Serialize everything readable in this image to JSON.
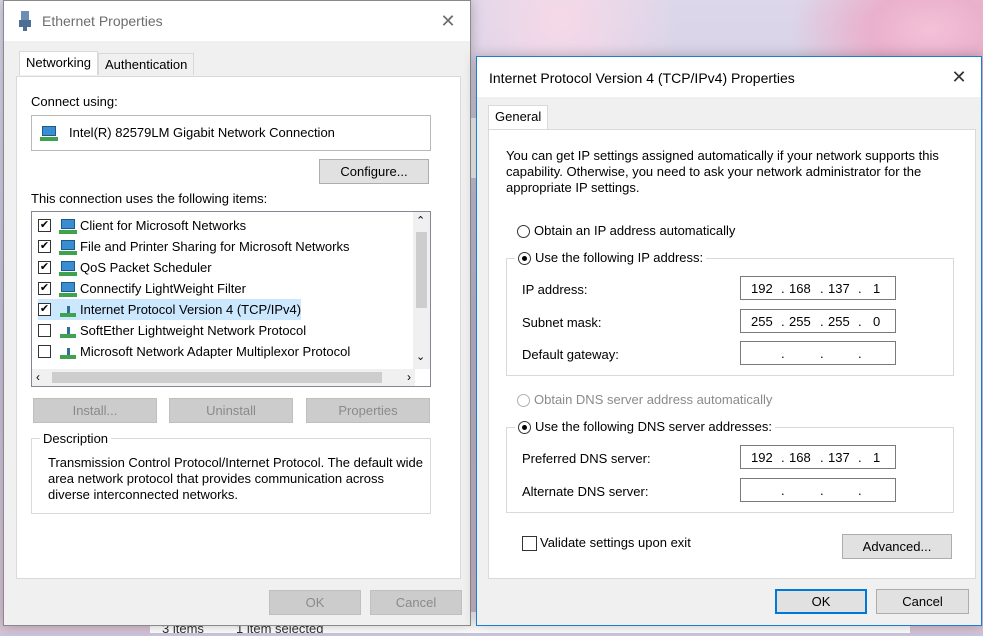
{
  "eth": {
    "title": "Ethernet Properties",
    "tabs": [
      "Networking",
      "Authentication"
    ],
    "connect_using_label": "Connect using:",
    "adapter_name": "Intel(R) 82579LM Gigabit Network Connection",
    "configure_label": "Configure...",
    "items_label": "This connection uses the following items:",
    "items": [
      {
        "label": "Client for Microsoft Networks",
        "checked": true
      },
      {
        "label": "File and Printer Sharing for Microsoft Networks",
        "checked": true
      },
      {
        "label": "QoS Packet Scheduler",
        "checked": true
      },
      {
        "label": "Connectify LightWeight Filter",
        "checked": true
      },
      {
        "label": "Internet Protocol Version 4 (TCP/IPv4)",
        "checked": true
      },
      {
        "label": "SoftEther Lightweight Network Protocol",
        "checked": false
      },
      {
        "label": "Microsoft Network Adapter Multiplexor Protocol",
        "checked": false
      }
    ],
    "install_label": "Install...",
    "uninstall_label": "Uninstall",
    "properties_label": "Properties",
    "description_title": "Description",
    "description_text": "Transmission Control Protocol/Internet Protocol. The default wide area network protocol that provides communication across diverse interconnected networks.",
    "ok_label": "OK",
    "cancel_label": "Cancel"
  },
  "ip": {
    "title": "Internet Protocol Version 4 (TCP/IPv4) Properties",
    "tab": "General",
    "intro": "You can get IP settings assigned automatically if your network supports this capability. Otherwise, you need to ask your network administrator for the appropriate IP settings.",
    "obtain_ip": "Obtain an IP address automatically",
    "use_ip": "Use the following IP address:",
    "ip_address_label": "IP address:",
    "ip_address": [
      "192",
      "168",
      "137",
      "1"
    ],
    "subnet_label": "Subnet mask:",
    "subnet": [
      "255",
      "255",
      "255",
      "0"
    ],
    "gateway_label": "Default gateway:",
    "obtain_dns": "Obtain DNS server address automatically",
    "use_dns": "Use the following DNS server addresses:",
    "preferred_dns_label": "Preferred DNS server:",
    "preferred_dns": [
      "192",
      "168",
      "137",
      "1"
    ],
    "alternate_dns_label": "Alternate DNS server:",
    "validate_label": "Validate settings upon exit",
    "advanced_label": "Advanced...",
    "ok_label": "OK",
    "cancel_label": "Cancel"
  },
  "explorer": {
    "items_count": "3 items",
    "selected": "1 item selected"
  },
  "colors": {
    "accent": "#0078d7",
    "selection": "#cce8ff"
  }
}
